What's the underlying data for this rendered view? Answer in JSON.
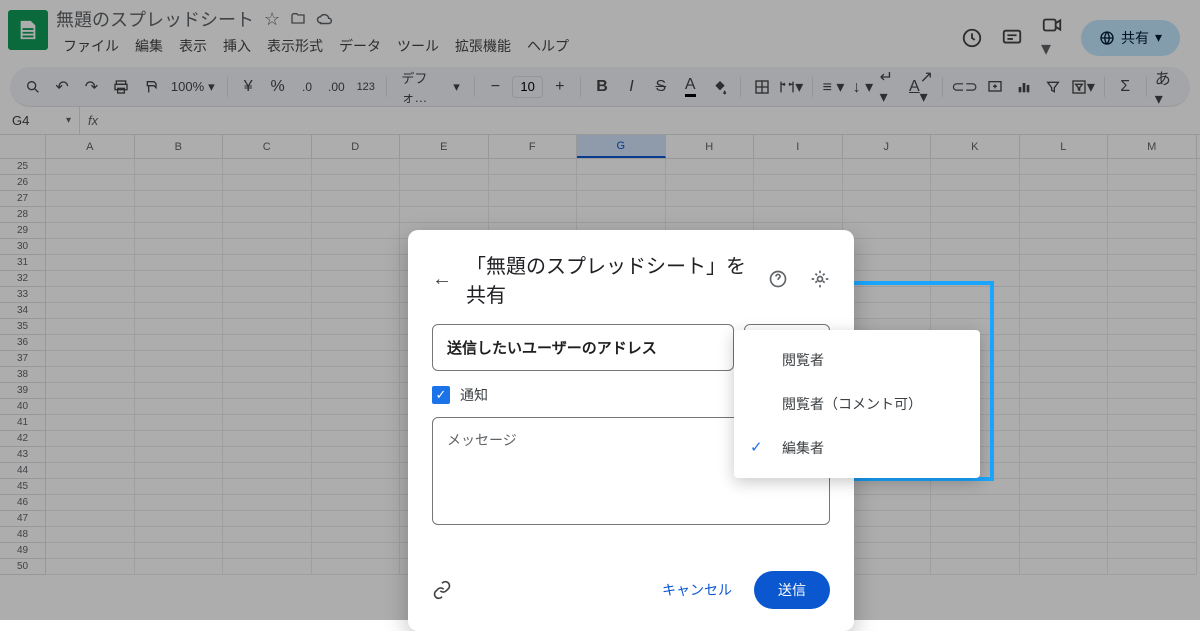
{
  "header": {
    "title": "無題のスプレッドシート",
    "menus": [
      "ファイル",
      "編集",
      "表示",
      "挿入",
      "表示形式",
      "データ",
      "ツール",
      "拡張機能",
      "ヘルプ"
    ],
    "share_label": "共有"
  },
  "toolbar": {
    "zoom": "100%",
    "font": "デフォ…",
    "font_size": "10"
  },
  "formula": {
    "cell_ref": "G4"
  },
  "columns": [
    "A",
    "B",
    "C",
    "D",
    "E",
    "F",
    "G",
    "H",
    "I",
    "J",
    "K",
    "L",
    "M"
  ],
  "row_start": 25,
  "row_end": 50,
  "selected_col": "G",
  "dialog": {
    "title": "「無題のスプレッドシート」を共有",
    "address_placeholder": "送信したいユーザーのアドレス",
    "role_selected": "編集者",
    "notify_label": "通知",
    "message_placeholder": "メッセージ",
    "cancel": "キャンセル",
    "send": "送信",
    "roles": [
      {
        "label": "閲覧者",
        "checked": false
      },
      {
        "label": "閲覧者（コメント可）",
        "checked": false
      },
      {
        "label": "編集者",
        "checked": true
      }
    ]
  }
}
